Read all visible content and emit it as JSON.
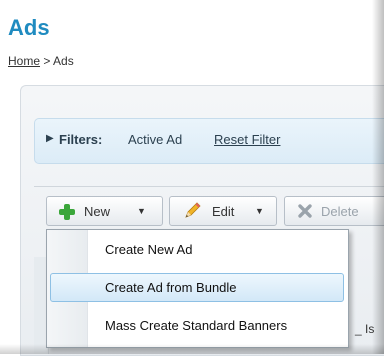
{
  "page": {
    "title": "Ads"
  },
  "breadcrumb": {
    "home": "Home",
    "separator": ">",
    "current": "Ads"
  },
  "filters": {
    "label": "Filters:",
    "value": "Active Ad",
    "reset": "Reset Filter"
  },
  "toolbar": {
    "new_label": "New",
    "edit_label": "Edit",
    "delete_label": "Delete",
    "icons": {
      "new": "plus-icon",
      "edit": "pencil-icon",
      "delete": "x-icon",
      "caret": "caret-down-icon"
    }
  },
  "new_menu": {
    "items": [
      {
        "label": "Create New Ad",
        "highlighted": false
      },
      {
        "label": "Create Ad from Bundle",
        "highlighted": true
      },
      {
        "label": "Mass Create Standard Banners",
        "highlighted": false
      }
    ]
  },
  "background_row": {
    "fragment": "_ Is"
  },
  "colors": {
    "title": "#1f8bc0",
    "menu_hover": "#d3e8f8",
    "filters_bg": "#eaf4fb",
    "plus_green": "#3aa63a"
  }
}
